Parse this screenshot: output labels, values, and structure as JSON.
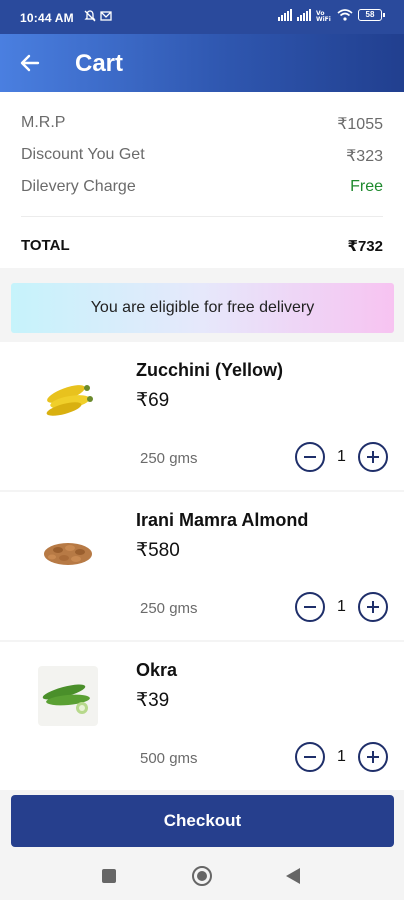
{
  "status_bar": {
    "time": "10:44 AM",
    "battery": "58",
    "icons": [
      "muted-alarm-icon",
      "mail-icon",
      "signal-icon",
      "signal-icon",
      "volte-icon",
      "wifi-icon",
      "battery-icon"
    ]
  },
  "app_bar": {
    "title": "Cart",
    "back_icon": "arrow-left-icon"
  },
  "summary": {
    "mrp_label": "M.R.P",
    "mrp_value": "₹1055",
    "discount_label": "Discount You Get",
    "discount_value": "₹323",
    "delivery_label": "Dilevery Charge",
    "delivery_value": "Free",
    "total_label": "TOTAL",
    "total_value": "₹732"
  },
  "banner": {
    "text": "You are eligible for free delivery"
  },
  "items": [
    {
      "name": "Zucchini (Yellow)",
      "price": "₹69",
      "weight": "250 gms",
      "quantity": "1"
    },
    {
      "name": "Irani Mamra Almond",
      "price": "₹580",
      "weight": "250 gms",
      "quantity": "1"
    },
    {
      "name": "Okra",
      "price": "₹39",
      "weight": "500 gms",
      "quantity": "1"
    }
  ],
  "checkout": {
    "label": "Checkout"
  },
  "colors": {
    "primary": "#263f8d",
    "free": "#1f8a2e",
    "appbar_start": "#4a7fe0",
    "appbar_end": "#213f8f"
  }
}
